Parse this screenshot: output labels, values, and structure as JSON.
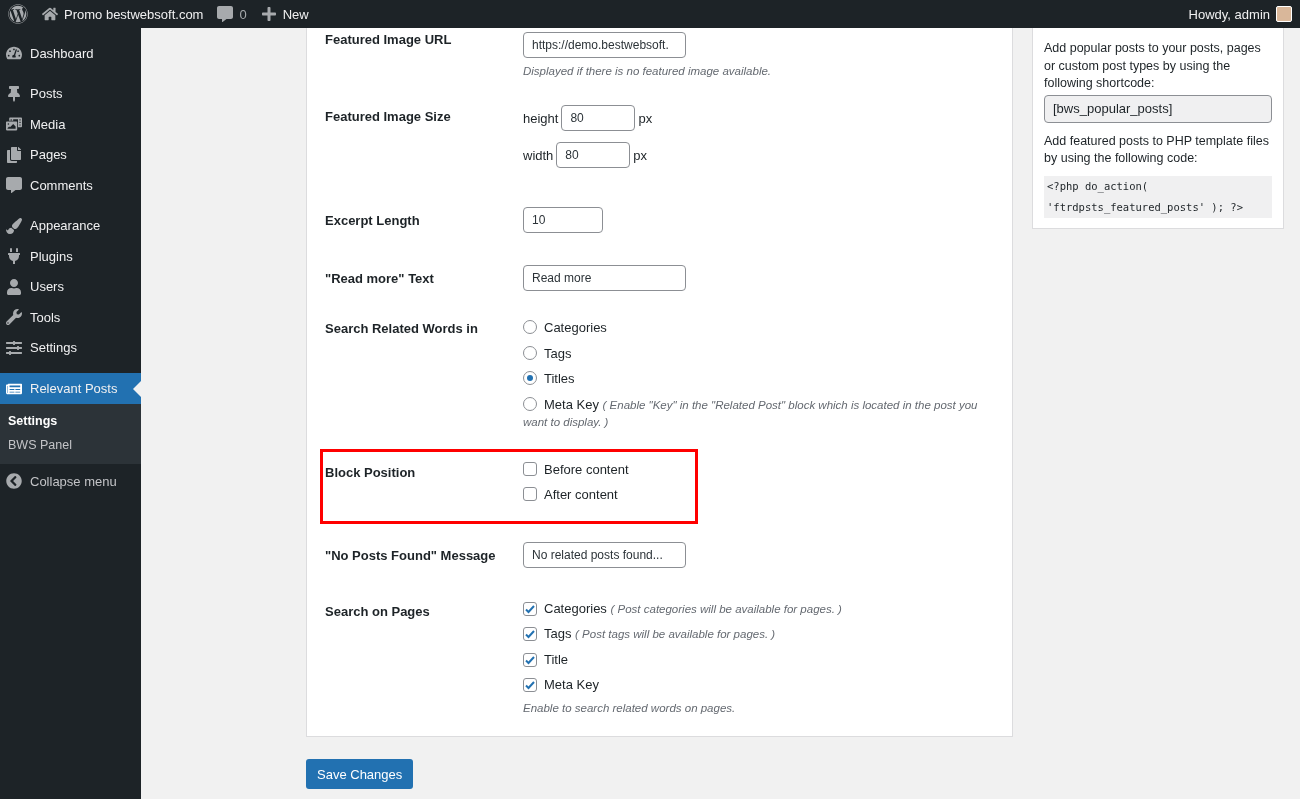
{
  "admin_bar": {
    "site": "Promo bestwebsoft.com",
    "comments": "0",
    "new": "New",
    "greeting": "Howdy, admin"
  },
  "sidebar": {
    "items": [
      {
        "label": "Dashboard",
        "selected": false
      },
      {
        "label": "Posts",
        "selected": false
      },
      {
        "label": "Media",
        "selected": false
      },
      {
        "label": "Pages",
        "selected": false
      },
      {
        "label": "Comments",
        "selected": false
      },
      {
        "label": "Appearance",
        "selected": false
      },
      {
        "label": "Plugins",
        "selected": false
      },
      {
        "label": "Users",
        "selected": false
      },
      {
        "label": "Tools",
        "selected": false
      },
      {
        "label": "Settings",
        "selected": false
      },
      {
        "label": "Relevant Posts",
        "selected": true,
        "children": [
          {
            "label": "Settings",
            "selected": true
          },
          {
            "label": "BWS Panel",
            "selected": false
          }
        ]
      }
    ],
    "collapse": "Collapse menu"
  },
  "form": {
    "rows": [
      {
        "kind": "text",
        "label": "Featured Image URL",
        "value": "https://demo.bestwebsoft.",
        "description": "Displayed if there is no featured image available."
      },
      {
        "kind": "size",
        "label": "Featured Image Size",
        "fields": [
          {
            "label": "height",
            "value": "80",
            "unit": "px"
          },
          {
            "label": "width",
            "value": "80",
            "unit": "px"
          }
        ]
      },
      {
        "kind": "short",
        "label": "Excerpt Length",
        "value": "10"
      },
      {
        "kind": "text",
        "label": "\"Read more\" Text",
        "value": "Read more"
      },
      {
        "kind": "radio",
        "label": "Search Related Words in",
        "options": [
          {
            "label": "Categories",
            "selected": false
          },
          {
            "label": "Tags",
            "selected": false
          },
          {
            "label": "Titles",
            "selected": true
          },
          {
            "label": "Meta Key",
            "selected": false,
            "note": "( Enable \"Key\" in the \"Related Post\" block which is located in the post you want to display. )"
          }
        ]
      },
      {
        "kind": "checkbox",
        "label": "Block Position",
        "highlighted": true,
        "options": [
          {
            "label": "Before content",
            "checked": false
          },
          {
            "label": "After content",
            "checked": false
          }
        ]
      },
      {
        "kind": "text",
        "label": "\"No Posts Found\" Message",
        "value": "No related posts found..."
      },
      {
        "kind": "checkbox",
        "label": "Search on Pages",
        "highlighted": false,
        "options": [
          {
            "label": "Categories",
            "checked": true,
            "note": "( Post categories will be available for pages. )"
          },
          {
            "label": "Tags",
            "checked": true,
            "note": "( Post tags will be available for pages. )"
          },
          {
            "label": "Title",
            "checked": true
          },
          {
            "label": "Meta Key",
            "checked": true
          }
        ],
        "description": "Enable to search related words on pages."
      }
    ],
    "submit": "Save Changes"
  },
  "side_widget": {
    "text_1": "Add popular posts to your posts, pages or custom post types by using the following shortcode:",
    "shortcode": "[bws_popular_posts]",
    "text_2": "Add featured posts to PHP template files by using the following code:",
    "code": "<?php do_action( 'ftrdpsts_featured_posts' ); ?>"
  }
}
